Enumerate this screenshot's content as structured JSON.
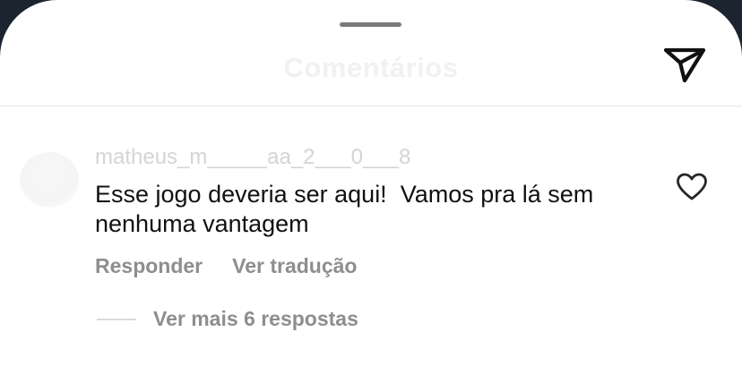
{
  "sheet": {
    "title": "Comentários",
    "share_icon": "send-paper-plane-icon"
  },
  "comment": {
    "username": "matheus_m_____aa_2___0___8",
    "text": "Esse jogo deveria ser aqui!  Vamos pra lá sem nenhuma vantagem",
    "like_icon": "heart-outline-icon",
    "reply_label": "Responder",
    "translate_label": "Ver tradução"
  },
  "replies": {
    "view_more_label": "Ver mais 6 respostas"
  },
  "colors": {
    "sheet_background": "#ffffff",
    "secondary_text": "#8e8e8e",
    "primary_text": "#111111"
  }
}
